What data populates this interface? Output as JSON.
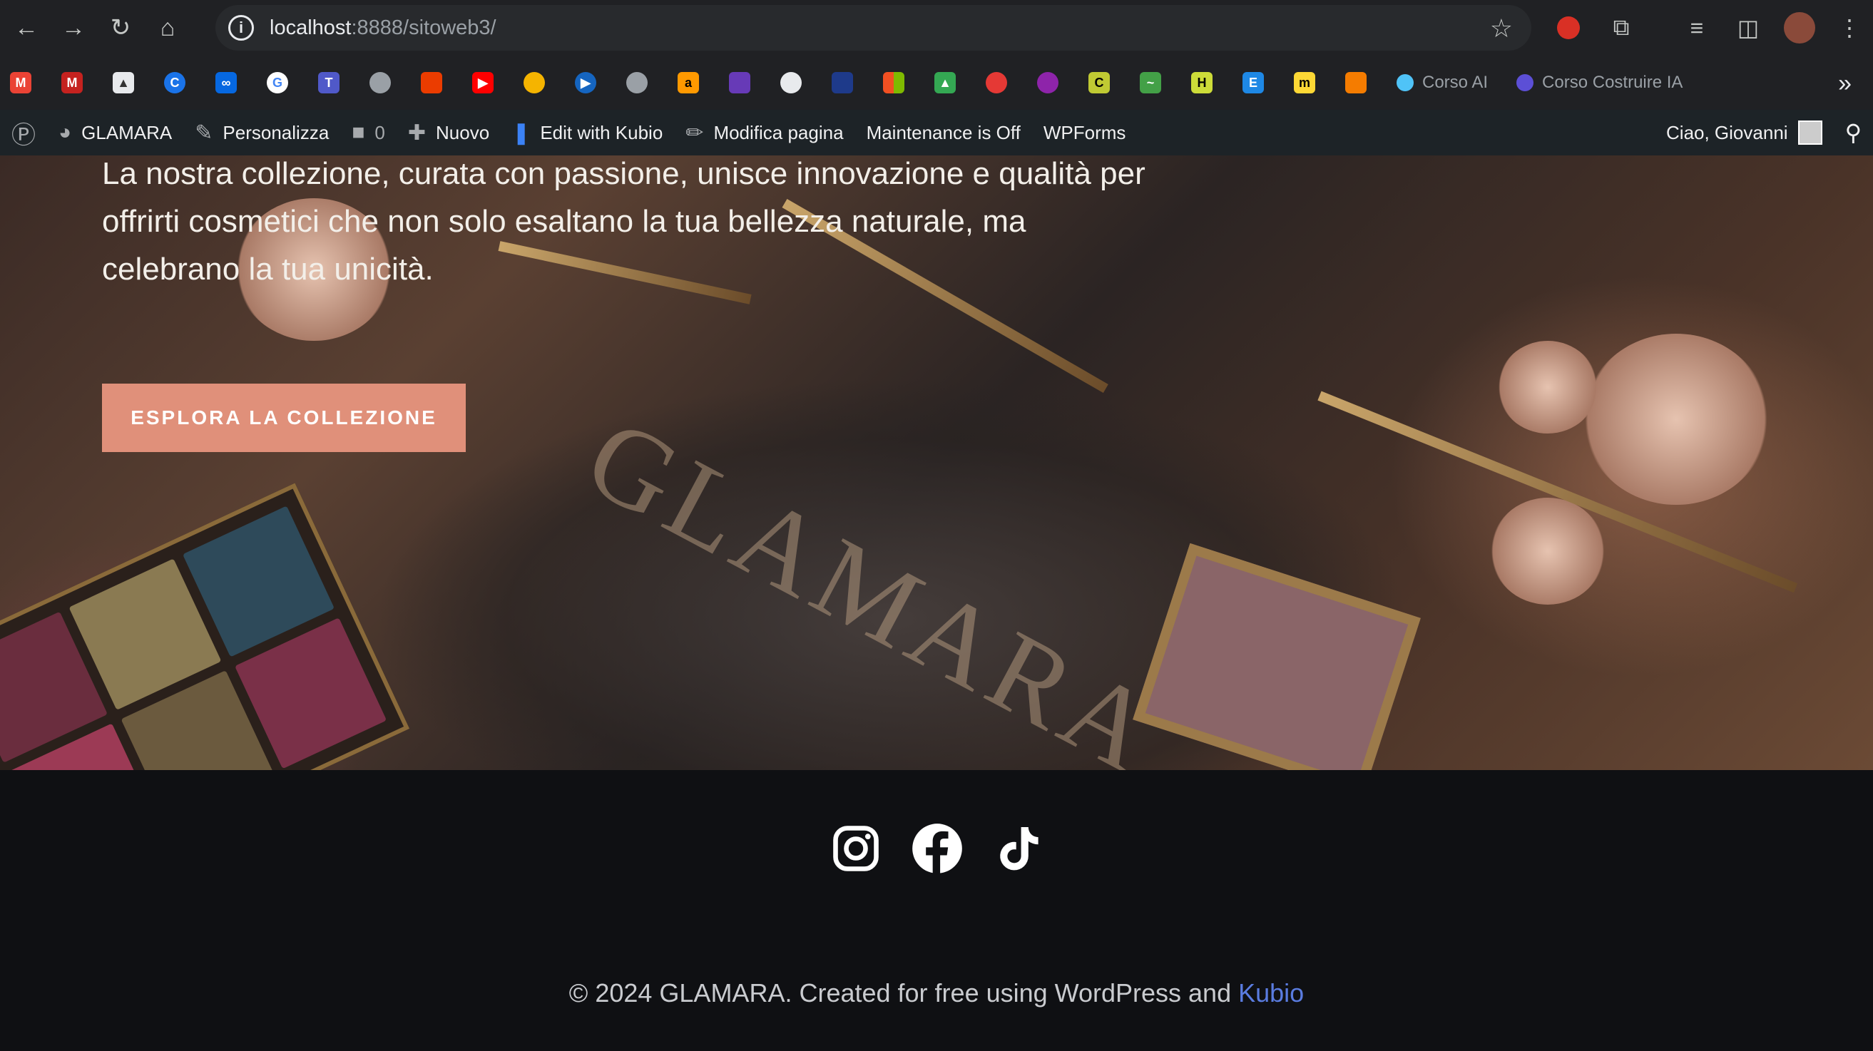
{
  "browser": {
    "url_host": "localhost",
    "url_rest": ":8888/sitoweb3/",
    "bookmark_folders": [
      {
        "label": "Corso AI",
        "color": "#4fc3f7"
      },
      {
        "label": "Corso Costruire IA",
        "color": "#5c4fd6"
      }
    ],
    "more_glyph": "»"
  },
  "wp_admin_bar": {
    "site_name": "GLAMARA",
    "customize": "Personalizza",
    "comments_count": "0",
    "new": "Nuovo",
    "edit_kubio": "Edit with Kubio",
    "edit_page": "Modifica pagina",
    "maintenance": "Maintenance is Off",
    "wpforms": "WPForms",
    "greeting": "Ciao, Giovanni"
  },
  "hero": {
    "text": "La nostra collezione, curata con passione, unisce innovazione e qualità per offrirti cosmetici che non solo esaltano la tua bellezza naturale, ma celebrano la tua unicità.",
    "cta_label": "ESPLORA LA COLLEZIONE",
    "watermark": "GLAMARA"
  },
  "footer": {
    "social": [
      "instagram-icon",
      "facebook-icon",
      "tiktok-icon"
    ],
    "copyright_prefix": "© 2024 GLAMARA. Created for free using WordPress and ",
    "copyright_link": "Kubio"
  },
  "colors": {
    "cta": "#e0907a",
    "footer_bg": "#0f1013",
    "link": "#5a7ce0"
  }
}
